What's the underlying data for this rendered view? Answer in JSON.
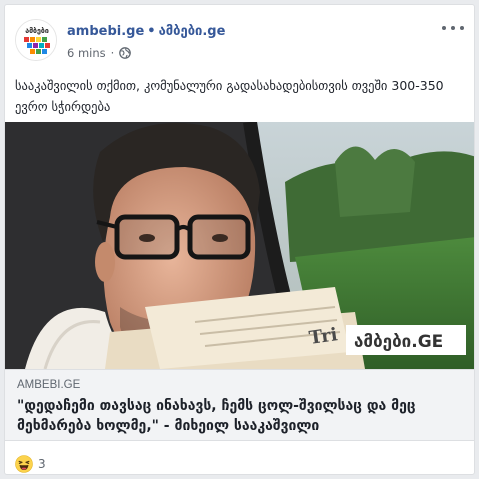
{
  "post": {
    "page_name": "ambebi.ge",
    "page_name_alt": "ამბები.ge",
    "separator": "•",
    "time": "6 mins",
    "meta_separator": "·",
    "privacy_icon": "globe-icon",
    "text": "სააკაშვილის თქმით, კომუნალური გადასახადებისთვის თვეში 300-350 ევრო სჭირდება",
    "more_icon": "ellipsis-icon"
  },
  "photo": {
    "watermark": "ამბები.GE",
    "newspaper_text": "Tri"
  },
  "link_preview": {
    "domain": "AMBEBI.GE",
    "title": "\"დედაჩემი თავსაც ინახავს, ჩემს ცოლ-შვილსაც და მეც მეხმარება ხოლმე,\" - მიხეილ სააკაშვილი"
  },
  "reactions": {
    "icon": "haha-icon",
    "count": "3"
  },
  "colors": {
    "link_blue": "#365899",
    "watermark_bg": "#ffffff",
    "watermark_text": "#333333",
    "watermark_accent": "#e8452c"
  }
}
